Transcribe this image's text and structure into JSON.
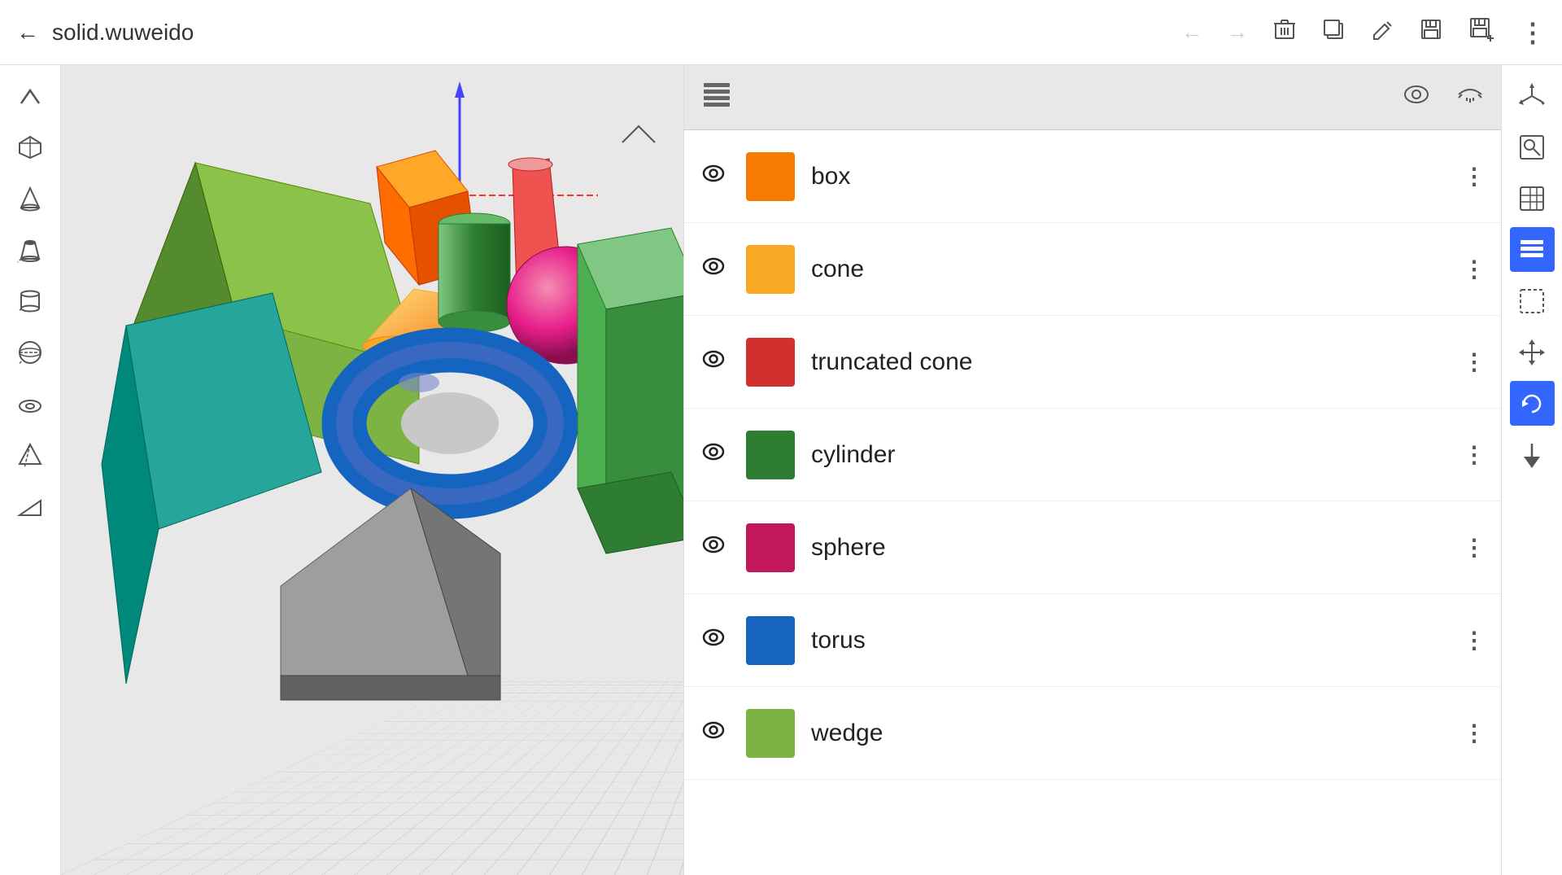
{
  "header": {
    "back_label": "←",
    "title": "solid.wuweido",
    "nav": {
      "back": "←",
      "forward": "→",
      "delete": "🗑",
      "duplicate": "⊞",
      "edit": "✏",
      "save": "💾",
      "save_plus": "💾+",
      "more": "⋮"
    }
  },
  "panel": {
    "header_icon": "≡",
    "eye_icon": "👁",
    "close_eye_icon": "~"
  },
  "layers": [
    {
      "name": "box",
      "color": "#f57c00",
      "visible": true
    },
    {
      "name": "cone",
      "color": "#f9a825",
      "visible": true
    },
    {
      "name": "truncated cone",
      "color": "#d32f2f",
      "visible": true
    },
    {
      "name": "cylinder",
      "color": "#2e7d32",
      "visible": true
    },
    {
      "name": "sphere",
      "color": "#c2185b",
      "visible": true
    },
    {
      "name": "torus",
      "color": "#1565c0",
      "visible": true
    },
    {
      "name": "wedge",
      "color": "#7cb342",
      "visible": true
    }
  ],
  "left_tools": [
    "chevron-up",
    "cube",
    "cone",
    "truncated-cone",
    "cylinder",
    "sphere-with-lines",
    "torus",
    "pyramid",
    "wedge"
  ],
  "right_tools": [
    "axis-icon",
    "search-box-icon",
    "grid-icon",
    "layers-icon",
    "select-icon",
    "move-icon",
    "rotate-icon",
    "arrow-down-icon"
  ],
  "viewport": {
    "axis_label": "↑"
  }
}
